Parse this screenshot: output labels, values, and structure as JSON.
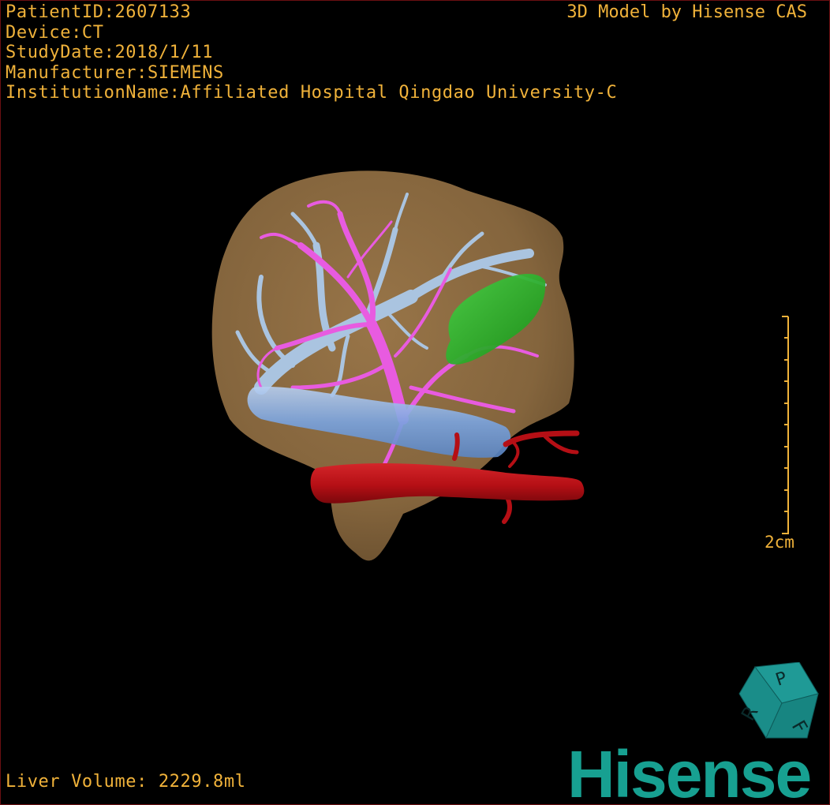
{
  "header": {
    "patient_id": "PatientID:2607133",
    "device": "Device:CT",
    "study_date": "StudyDate:2018/1/11",
    "manufacturer": "Manufacturer:SIEMENS",
    "institution": "InstitutionName:Affiliated Hospital Qingdao University-C",
    "model_credit": "3D Model by Hisense CAS"
  },
  "footer": {
    "liver_volume": "Liver Volume: 2229.8ml",
    "brand_logo": "Hisense"
  },
  "scale_bar": {
    "label": "2cm"
  },
  "orientation_cube": {
    "faces": [
      "P",
      "R",
      "F"
    ]
  },
  "colors": {
    "overlay_text": "#f0b23a",
    "liver": "#8b6a40",
    "hepatic_vein": "#aac4e0",
    "portal_vein": "#e85be0",
    "ivc": "#7aa4e0",
    "artery": "#b50f15",
    "gallbladder": "#22bb22",
    "brand": "#17a091"
  },
  "icons": [
    "liver-3d-model",
    "orientation-cube",
    "hisense-logo"
  ]
}
